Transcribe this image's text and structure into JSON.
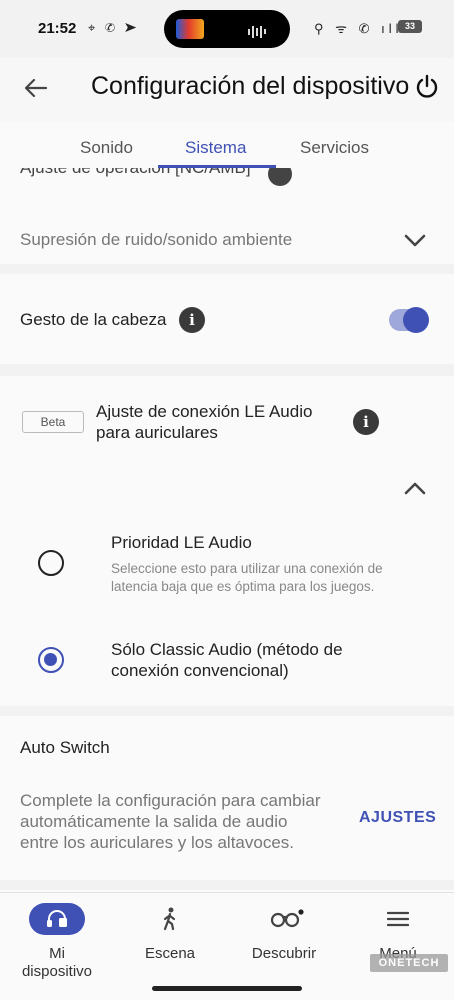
{
  "status_bar": {
    "time": "21:52",
    "left_icons": "⌖ ✆ ➤",
    "right_icons": "⚲ ᯤ ✆ ıll",
    "battery": "33"
  },
  "header": {
    "title": "Configuración del dispositivo",
    "back_icon": "arrow-left-icon",
    "power_icon": "power-icon"
  },
  "tabs": [
    {
      "label": "Sonido",
      "active": false
    },
    {
      "label": "Sistema",
      "active": true
    },
    {
      "label": "Servicios",
      "active": false
    }
  ],
  "sections": {
    "noise": {
      "cut_label": "Ajuste de operación [NC/AMB]",
      "dropdown_label": "Supresión de ruido/sonido ambiente"
    },
    "head_gesture": {
      "label": "Gesto de la cabeza",
      "enabled": true
    },
    "le_audio": {
      "badge": "Beta",
      "title_line1": "Ajuste de conexión LE Audio",
      "title_line2": "para auriculares",
      "options": [
        {
          "title": "Prioridad LE Audio",
          "desc_line1": "Seleccione esto para utilizar una conexión de",
          "desc_line2": "latencia baja que es óptima para los juegos.",
          "selected": false
        },
        {
          "title_line1": "Sólo Classic Audio (método de",
          "title_line2": "conexión convencional)",
          "selected": true
        }
      ]
    },
    "auto_switch": {
      "title": "Auto Switch",
      "desc_line1": "Complete la configuración para cambiar",
      "desc_line2": "automáticamente la salida de audio",
      "desc_line3": "entre los auriculares y los altavoces.",
      "action": "AJUSTES"
    }
  },
  "bottom_nav": [
    {
      "label_line1": "Mi",
      "label_line2": "dispositivo",
      "icon": "headphones-icon",
      "active": true
    },
    {
      "label": "Escena",
      "icon": "walking-person-icon",
      "active": false
    },
    {
      "label": "Descubrir",
      "icon": "binoculars-icon",
      "active": false
    },
    {
      "label": "Menú",
      "icon": "menu-icon",
      "active": false
    }
  ],
  "watermark": "ONETECH",
  "colors": {
    "accent": "#3f51b5",
    "toggle_track": "#9fa8da",
    "background": "#f2f2f2",
    "card": "#fafafa"
  }
}
